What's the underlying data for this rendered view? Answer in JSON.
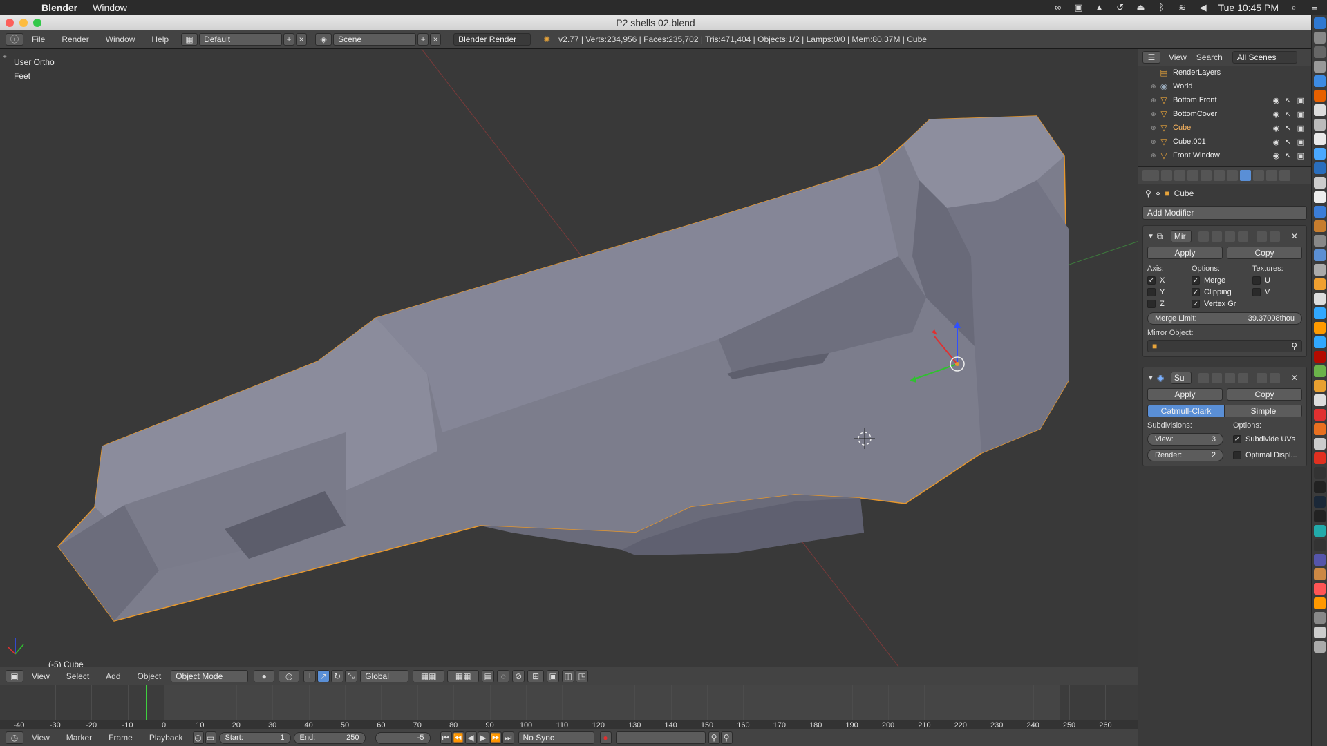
{
  "mac": {
    "app_name": "Blender",
    "menu_window": "Window",
    "clock": "Tue 10:45 PM"
  },
  "window": {
    "title": "P2 shells 02.blend"
  },
  "info_header": {
    "menus": [
      "File",
      "Render",
      "Window",
      "Help"
    ],
    "layout": "Default",
    "scene": "Scene",
    "engine": "Blender Render",
    "stats": "v2.77 | Verts:234,956 | Faces:235,702 | Tris:471,404 | Objects:1/2 | Lamps:0/0 | Mem:80.37M | Cube"
  },
  "viewport": {
    "view_name": "User Ortho",
    "units": "Feet",
    "object_label": "(-5) Cube"
  },
  "view_header": {
    "menus": [
      "View",
      "Select",
      "Add",
      "Object"
    ],
    "mode": "Object Mode",
    "orientation": "Global"
  },
  "timeline": {
    "ticks": [
      "-40",
      "-30",
      "-20",
      "-10",
      "0",
      "10",
      "20",
      "30",
      "40",
      "50",
      "60",
      "70",
      "80",
      "90",
      "100",
      "110",
      "120",
      "130",
      "140",
      "150",
      "160",
      "170",
      "180",
      "190",
      "200",
      "210",
      "220",
      "230",
      "240",
      "250",
      "260"
    ],
    "current_frame": -5
  },
  "timeline_header": {
    "menus": [
      "View",
      "Marker",
      "Frame",
      "Playback"
    ],
    "start_label": "Start:",
    "start_value": "1",
    "end_label": "End:",
    "end_value": "250",
    "current": "-5",
    "sync": "No Sync"
  },
  "outliner": {
    "menus": [
      "View",
      "Search"
    ],
    "filter": "All Scenes",
    "items": [
      {
        "name": "RenderLayers"
      },
      {
        "name": "World"
      },
      {
        "name": "Bottom Front"
      },
      {
        "name": "BottomCover"
      },
      {
        "name": "Cube"
      },
      {
        "name": "Cube.001"
      },
      {
        "name": "Front Window"
      }
    ]
  },
  "properties": {
    "context_object": "Cube",
    "add_modifier": "Add Modifier",
    "mirror": {
      "name": "Mir",
      "apply": "Apply",
      "copy": "Copy",
      "axis_label": "Axis:",
      "options_label": "Options:",
      "textures_label": "Textures:",
      "x": "X",
      "y": "Y",
      "z": "Z",
      "merge": "Merge",
      "clipping": "Clipping",
      "vertex_groups": "Vertex Gr",
      "u": "U",
      "v": "V",
      "merge_limit_label": "Merge Limit:",
      "merge_limit_value": "39.37008thou",
      "mirror_object_label": "Mirror Object:"
    },
    "subsurf": {
      "name": "Su",
      "apply": "Apply",
      "copy": "Copy",
      "catmull": "Catmull-Clark",
      "simple": "Simple",
      "subdivisions_label": "Subdivisions:",
      "options_label": "Options:",
      "view_label": "View:",
      "view_value": "3",
      "render_label": "Render:",
      "render_value": "2",
      "subdivide_uvs": "Subdivide UVs",
      "optimal_display": "Optimal Displ..."
    }
  }
}
